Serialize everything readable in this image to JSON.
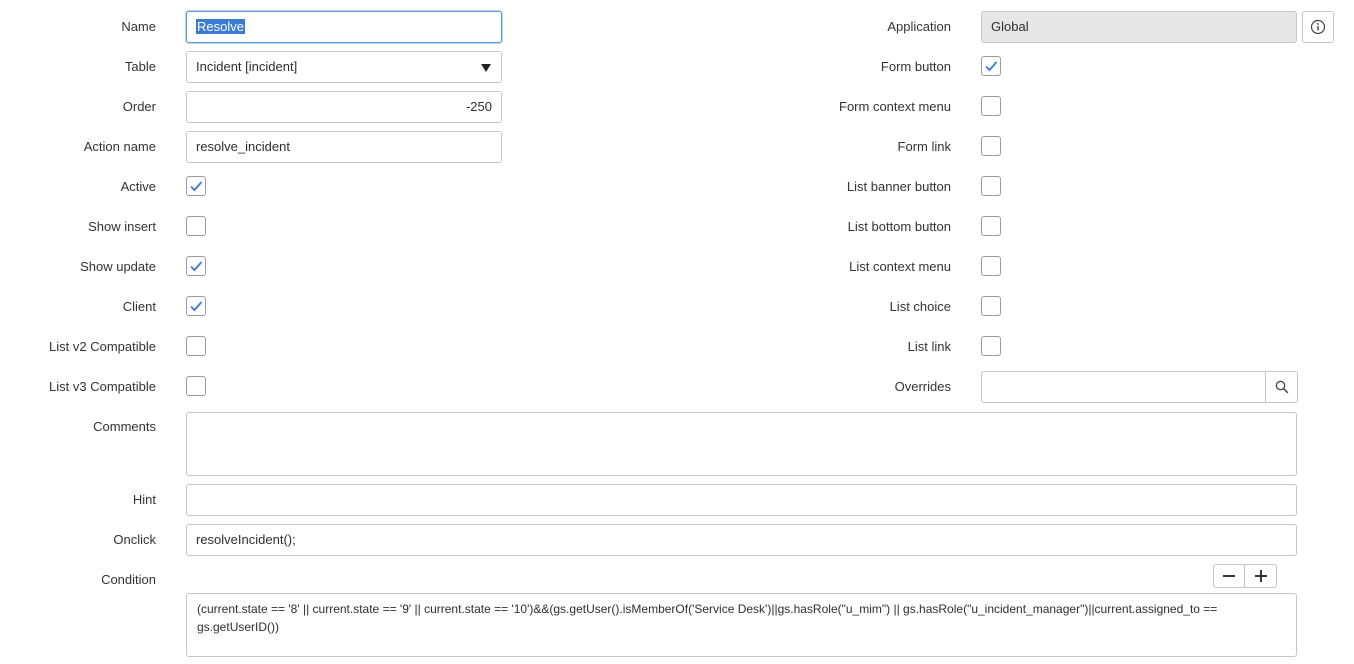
{
  "left": {
    "name": {
      "label": "Name",
      "value": "Resolve"
    },
    "table": {
      "label": "Table",
      "value": "Incident [incident]"
    },
    "order": {
      "label": "Order",
      "value": "-250"
    },
    "action_name": {
      "label": "Action name",
      "value": "resolve_incident"
    },
    "active": {
      "label": "Active",
      "checked": true
    },
    "show_insert": {
      "label": "Show insert",
      "checked": false
    },
    "show_update": {
      "label": "Show update",
      "checked": true
    },
    "client": {
      "label": "Client",
      "checked": true
    },
    "list_v2": {
      "label": "List v2 Compatible",
      "checked": false
    },
    "list_v3": {
      "label": "List v3 Compatible",
      "checked": false
    }
  },
  "right": {
    "application": {
      "label": "Application",
      "value": "Global",
      "info_icon": "info-icon"
    },
    "form_button": {
      "label": "Form button",
      "checked": true
    },
    "form_context_menu": {
      "label": "Form context menu",
      "checked": false
    },
    "form_link": {
      "label": "Form link",
      "checked": false
    },
    "list_banner_button": {
      "label": "List banner button",
      "checked": false
    },
    "list_bottom_button": {
      "label": "List bottom button",
      "checked": false
    },
    "list_context_menu": {
      "label": "List context menu",
      "checked": false
    },
    "list_choice": {
      "label": "List choice",
      "checked": false
    },
    "list_link": {
      "label": "List link",
      "checked": false
    },
    "overrides": {
      "label": "Overrides",
      "value": "",
      "search_icon": "search-icon"
    }
  },
  "full": {
    "comments": {
      "label": "Comments",
      "value": ""
    },
    "hint": {
      "label": "Hint",
      "value": ""
    },
    "onclick": {
      "label": "Onclick",
      "value": "resolveIncident();"
    },
    "condition": {
      "label": "Condition",
      "line1": "(current.state == '8'  ||  current.state == '9' || current.state == '10')&&(gs.getUser().isMemberOf('Service Desk')||gs.hasRole(\"u_mim\") || gs.hasRole(\"u_incident_manager\")||current.assigned_to ==",
      "line2": "gs.getUserID())",
      "minus_icon": "minus-icon",
      "plus_icon": "plus-icon"
    }
  },
  "colors": {
    "check": "#3a7bd5",
    "focus_border": "#5f9ad8",
    "readonly_bg": "#e6e6e6"
  }
}
